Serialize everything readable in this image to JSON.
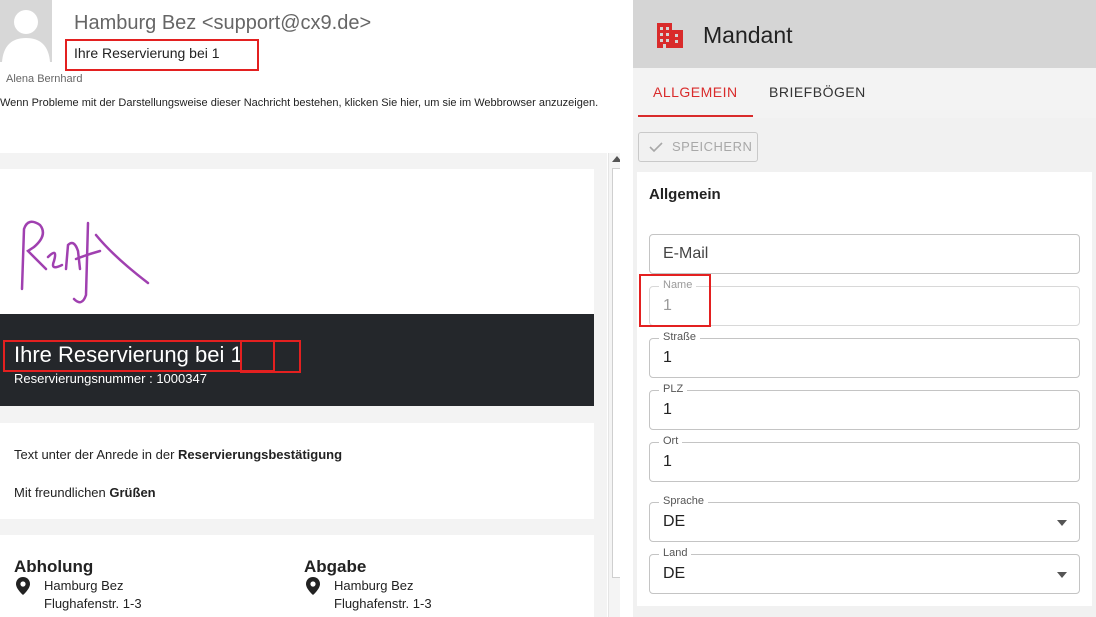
{
  "email": {
    "sender": "Hamburg Bez <support@cx9.de>",
    "subject": "Ihre Reservierung bei 1",
    "recipient": "Alena Bernhard",
    "notice": "Wenn Probleme mit der Darstellungsweise dieser Nachricht bestehen, klicken Sie hier, um sie im Webbrowser anzuzeigen."
  },
  "mail_body": {
    "logo_text": "Rent",
    "hero_title_prefix": "Ihre Reservierung bei",
    "hero_title_value": "1",
    "reservation_number": "Reservierungsnummer : 1000347",
    "para1_prefix": "Text unter der Anrede in der ",
    "para1_bold": "Reservierungsbestätigung",
    "para2_prefix": "Mit freundlichen ",
    "para2_bold": "Grüßen",
    "pickup": {
      "heading": "Abholung",
      "name": "Hamburg Bez",
      "street": "Flughafenstr. 1-3"
    },
    "dropoff": {
      "heading": "Abgabe",
      "name": "Hamburg Bez",
      "street": "Flughafenstr. 1-3"
    }
  },
  "panel": {
    "title": "Mandant",
    "tabs": [
      "ALLGEMEIN",
      "BRIEFBÖGEN"
    ],
    "save_label": "SPEICHERN",
    "section_title": "Allgemein",
    "fields": {
      "email": {
        "placeholder": "E-Mail"
      },
      "name": {
        "label": "Name",
        "value": "1"
      },
      "strasse": {
        "label": "Straße",
        "value": "1"
      },
      "plz": {
        "label": "PLZ",
        "value": "1"
      },
      "ort": {
        "label": "Ort",
        "value": "1"
      },
      "sprache": {
        "label": "Sprache",
        "value": "DE"
      },
      "land": {
        "label": "Land",
        "value": "DE"
      }
    }
  },
  "colors": {
    "accent": "#d92b2b",
    "annotation": "#e32020",
    "hero_bg": "#24272b",
    "signature": "#a040b0"
  }
}
